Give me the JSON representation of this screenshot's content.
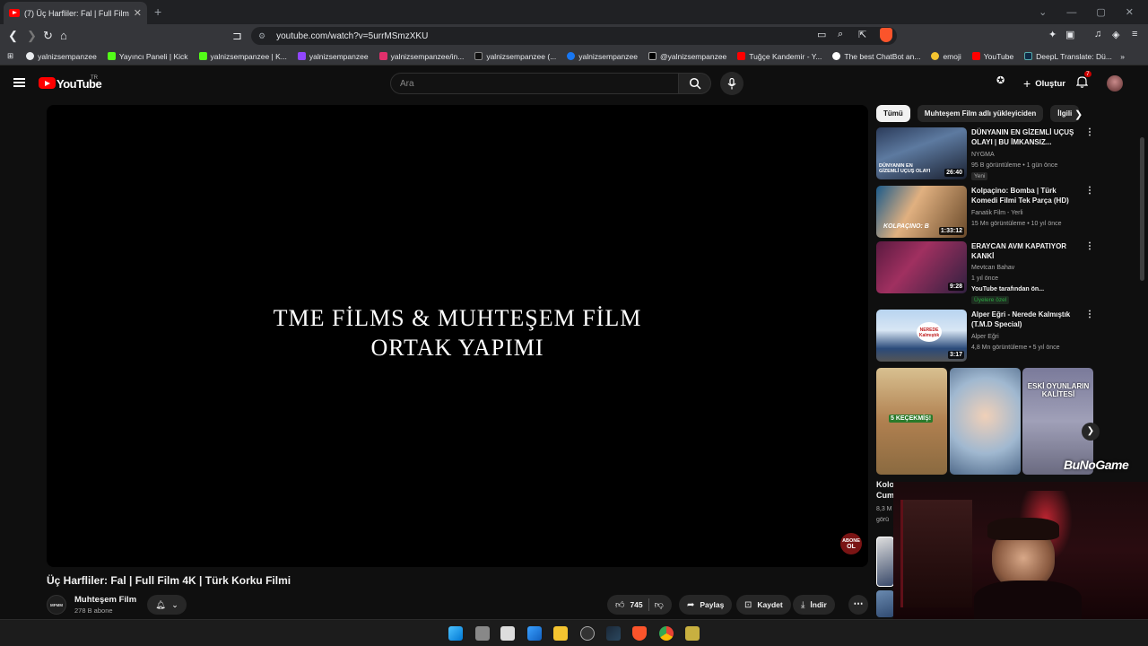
{
  "browser": {
    "tab_title": "(7) Üç Harfliler: Fal | Full Film 4K",
    "tab_close": "✕",
    "new_tab": "+",
    "url": "youtube.com/watch?v=5urrMSmzXKU",
    "bookmarks": [
      {
        "label": "yalnizsempanzee",
        "color": "#e8eaed"
      },
      {
        "label": "Yayıncı Paneli | Kick",
        "color": "#53fc18"
      },
      {
        "label": "yalnizsempanzee | K...",
        "color": "#53fc18"
      },
      {
        "label": "yalnizsempanzee",
        "color": "#9146ff"
      },
      {
        "label": "yalnizsempanzee/in...",
        "color": "#e1306c"
      },
      {
        "label": "yalnizsempanzee (...",
        "color": "#111111"
      },
      {
        "label": "yalnizsempanzee",
        "color": "#1877f2"
      },
      {
        "label": "@yalnizsempanzee",
        "color": "#000000"
      },
      {
        "label": "Tuğçe Kandemir - Y...",
        "color": "#ff0000"
      },
      {
        "label": "The best ChatBot an...",
        "color": "#ffffff"
      },
      {
        "label": "emoji",
        "color": "#f4c430"
      },
      {
        "label": "YouTube",
        "color": "#ff0000"
      },
      {
        "label": "DeepL Translate: Dü...",
        "color": "#0f2b46"
      }
    ]
  },
  "youtube": {
    "logo_text": "YouTube",
    "country_code": "TR",
    "search_placeholder": "Ara",
    "create_label": "Oluştur",
    "notification_count": "7",
    "video": {
      "overlay_line1": "TME FİLMS & MUHTEŞEM FİLM",
      "overlay_line2": "ORTAK YAPIMI",
      "subscribe_badge_line1": "ABONE",
      "subscribe_badge_line2": "OL",
      "title": "Üç Harfliler: Fal | Full Film 4K | Türk Korku Filmi",
      "channel": "Muhteşem Film",
      "channel_avatar_text": "MFMM",
      "subscribers": "278 B abone",
      "likes": "745",
      "share_label": "Paylaş",
      "save_label": "Kaydet",
      "download_label": "İndir"
    },
    "chips": [
      "Tümü",
      "Muhteşem Film adlı yükleyiciden",
      "İlgili"
    ],
    "recommendations": [
      {
        "title": "DÜNYANIN EN GİZEMLİ UÇUŞ OLAYI | BU İMKANSIZ...",
        "channel": "NYGMA",
        "meta": "95 B görüntüleme • 1 gün önce",
        "tag": "Yeni",
        "duration": "26:40",
        "thumb_text": "DÜNYANIN EN GİZEMLİ UÇUŞ OLAYI"
      },
      {
        "title": "Kolpaçino: Bomba | Türk Komedi Filmi Tek Parça (HD)",
        "channel": "Fanatik Film - Yerli",
        "meta": "15 Mn görüntüleme • 10 yıl önce",
        "tag": "",
        "duration": "1:33:12",
        "thumb_text": "KOLPAÇINO: B"
      },
      {
        "title": "ERAYCAN AVM KAPATIYOR KANKİ",
        "channel": "Mevtcan Bahav",
        "meta": "1 yıl önce",
        "meta2": "YouTube tarafından ön...",
        "tag": "Üyelere özel",
        "duration": "9:28",
        "thumb_text": ""
      },
      {
        "title": "Alper Eğri - Nerede Kalmıştık (T.M.D Special)",
        "channel": "Alper Eğri",
        "meta": "4,8 Mn görüntüleme • 5 yıl önce",
        "tag": "",
        "duration": "3:17",
        "thumb_text": "NEREDE Kalmıştık"
      }
    ],
    "shorts": [
      {
        "text": "5 KEÇEKMİŞ!",
        "label": "Kolo",
        "label2": "Cum",
        "meta": "8,3 M",
        "meta2": "görü"
      },
      {
        "text": "",
        "label": "S",
        "label2": "",
        "meta": "",
        "meta2": ""
      },
      {
        "text": "ESKİ OYUNLARIN KALİTESİ",
        "label": "",
        "label2": "",
        "meta": "",
        "meta2": ""
      }
    ],
    "watermark": "BuNoGame"
  }
}
